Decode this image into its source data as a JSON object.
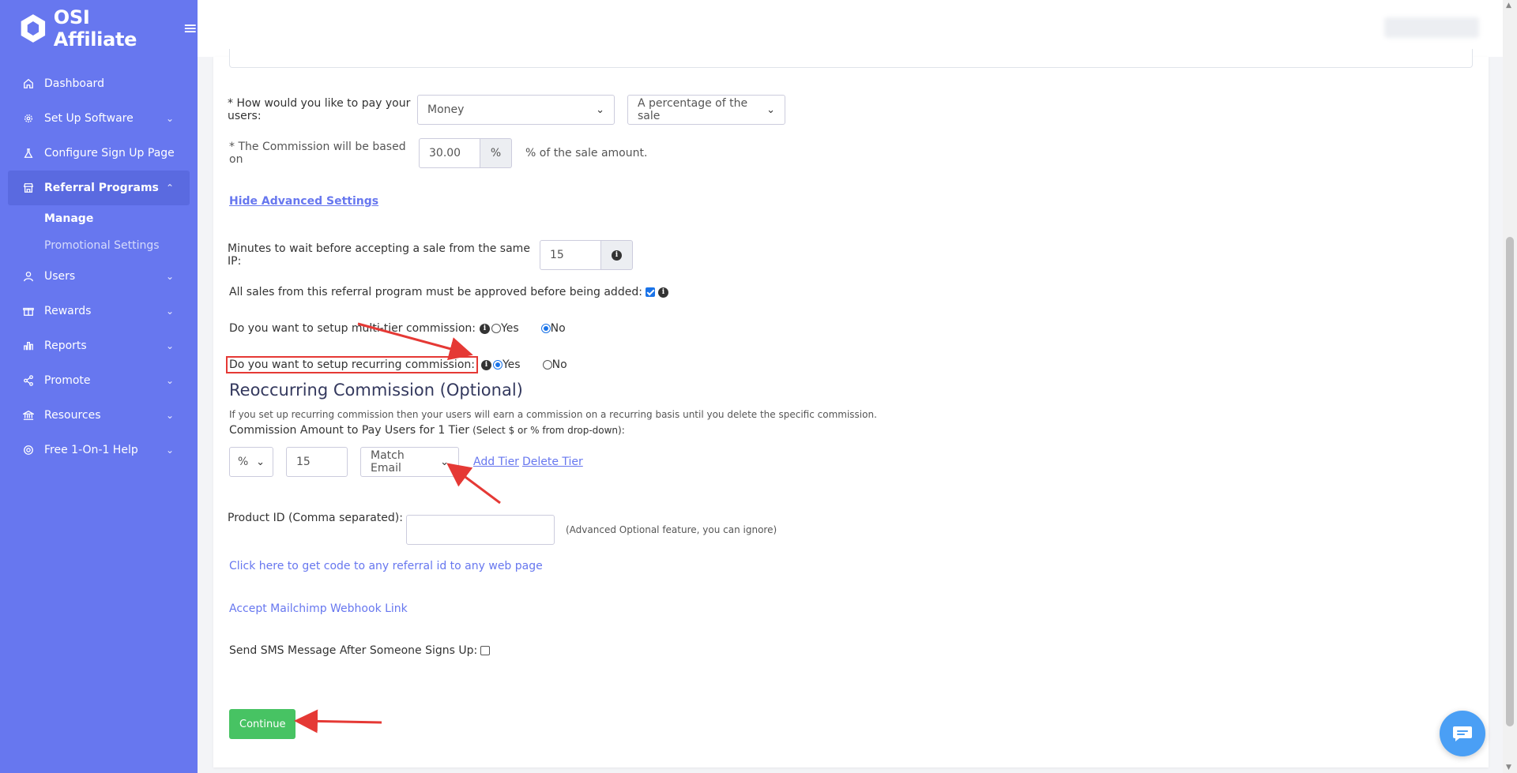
{
  "brand": {
    "name": "OSI Affiliate"
  },
  "sidebar": {
    "items": [
      {
        "label": "Dashboard",
        "icon": "home-icon"
      },
      {
        "label": "Set Up Software",
        "icon": "gear-icon",
        "expandable": true
      },
      {
        "label": "Configure Sign Up Page",
        "icon": "flask-icon"
      },
      {
        "label": "Referral Programs",
        "icon": "store-icon",
        "expanded": true,
        "active": true
      },
      {
        "label": "Users",
        "icon": "user-icon",
        "expandable": true
      },
      {
        "label": "Rewards",
        "icon": "gift-icon",
        "expandable": true
      },
      {
        "label": "Reports",
        "icon": "chart-icon",
        "expandable": true
      },
      {
        "label": "Promote",
        "icon": "share-icon",
        "expandable": true
      },
      {
        "label": "Resources",
        "icon": "bank-icon",
        "expandable": true
      },
      {
        "label": "Free 1-On-1 Help",
        "icon": "help-icon",
        "expandable": true
      }
    ],
    "subitems": [
      {
        "label": "Manage",
        "current": true
      },
      {
        "label": "Promotional Settings",
        "current": false
      }
    ]
  },
  "form": {
    "pay_label": "* How would you like to pay your users:",
    "pay_type": "Money",
    "pay_basis": "A percentage of the sale",
    "commission_label": "* The Commission will be based on",
    "commission_value": "30.00",
    "commission_unit": "%",
    "commission_suffix": "% of the sale amount.",
    "hide_advanced": "Hide Advanced Settings",
    "minutes_label": "Minutes to wait before accepting a sale from the same IP:",
    "minutes_value": "15",
    "approve_label": "All sales from this referral program must be approved before being added:",
    "approve_checked": true,
    "multitier_label": "Do you want to setup multi-tier commission:",
    "multitier_choice": "No",
    "recurring_label": "Do you want to setup recurring commission:",
    "recurring_choice": "Yes",
    "yes": "Yes",
    "no": "No"
  },
  "recurring": {
    "heading": "Reoccurring Commission (Optional)",
    "description": "If you set up recurring commission then your users will earn a commission on a recurring basis until you delete the specific commission.",
    "amount_label": "Commission Amount to Pay Users for 1 Tier",
    "amount_hint": "(Select $ or % from drop-down):",
    "unit": "%",
    "amount": "15",
    "match": "Match Email",
    "add_tier": "Add Tier",
    "delete_tier": "Delete Tier"
  },
  "product": {
    "label": "Product ID (Comma separated):",
    "value": "",
    "hint": "(Advanced Optional feature, you can ignore)"
  },
  "links": {
    "referral_code": "Click here to get code to any referral id to any web page",
    "mailchimp": "Accept Mailchimp Webhook Link"
  },
  "sms": {
    "label": "Send SMS Message After Someone Signs Up:",
    "checked": false
  },
  "actions": {
    "continue": "Continue"
  },
  "colors": {
    "sidebar": "#6777ef",
    "primary_link": "#6777ef",
    "continue": "#47c363",
    "annotation": "#e53935",
    "chat": "#4a9ff5"
  }
}
